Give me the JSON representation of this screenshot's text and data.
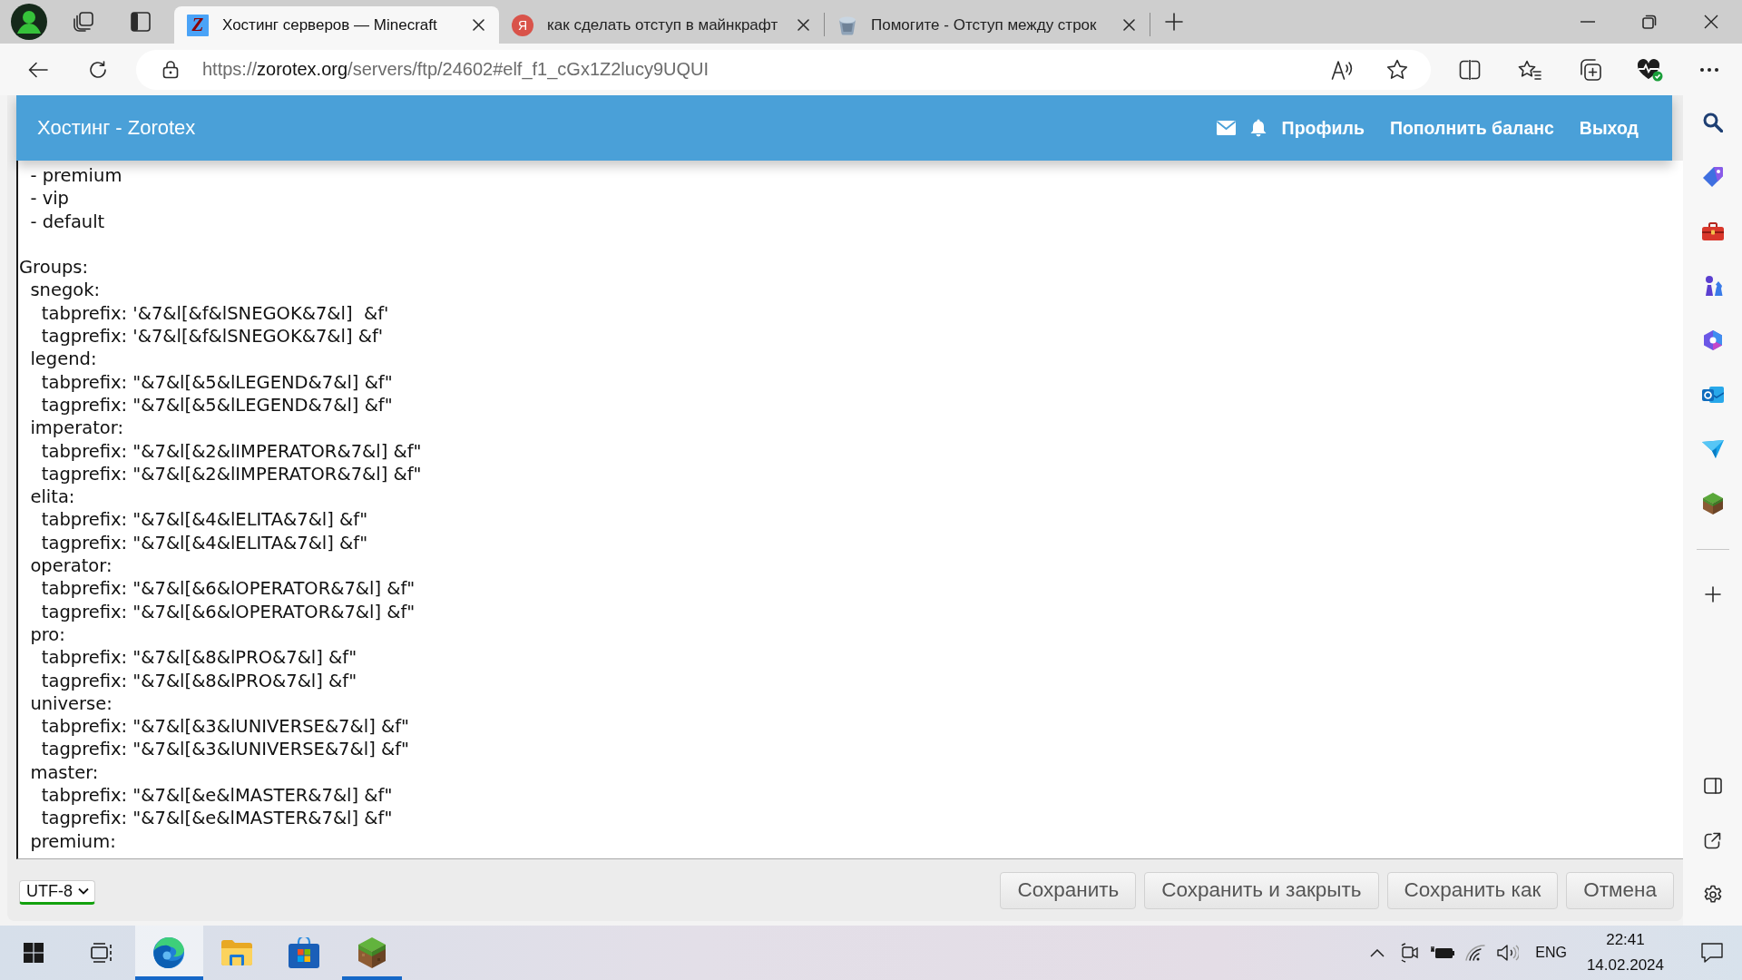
{
  "browser": {
    "tabs": [
      {
        "favicon": {
          "kind": "square",
          "letter": "Z"
        },
        "title": "Хостинг серверов — Minecraft",
        "selected": true
      },
      {
        "favicon": {
          "kind": "circle",
          "letter": "Я"
        },
        "title": "как сделать отступ в майнкрафт",
        "selected": false
      },
      {
        "favicon": {
          "kind": "picture"
        },
        "title": "Помогите - Отступ между строк",
        "selected": false
      }
    ],
    "address": {
      "scheme": "https://",
      "host": "zorotex.org",
      "path": "/servers/ftp/24602#elf_f1_cGx1Z2lucy9UQUI"
    }
  },
  "site": {
    "title": "Хостинг - Zorotex",
    "links": [
      "Профиль",
      "Пополнить баланс",
      "Выход"
    ]
  },
  "editor": {
    "blocks": [
      {
        "lines": [
          "  - premium",
          "  - vip",
          "  - default"
        ]
      },
      {
        "lines": [
          "Groups:",
          "  snegok:",
          "    tabprefix: '&7&l[&f&lSNEGOK&7&l]  &f'",
          "    tagprefix: '&7&l[&f&lSNEGOK&7&l] &f'",
          "  legend:",
          "    tabprefix: \"&7&l[&5&lLEGEND&7&l] &f\"",
          "    tagprefix: \"&7&l[&5&lLEGEND&7&l] &f\"",
          "  imperator:",
          "    tabprefix: \"&7&l[&2&lIMPERATOR&7&l] &f\"",
          "    tagprefix: \"&7&l[&2&lIMPERATOR&7&l] &f\"",
          "  elita:",
          "    tabprefix: \"&7&l[&4&lELITA&7&l] &f\"",
          "    tagprefix: \"&7&l[&4&lELITA&7&l] &f\"",
          "  operator:",
          "    tabprefix: \"&7&l[&6&lOPERATOR&7&l] &f\"",
          "    tagprefix: \"&7&l[&6&lOPERATOR&7&l] &f\"",
          "  pro:",
          "    tabprefix: \"&7&l[&8&lPRO&7&l] &f\"",
          "    tagprefix: \"&7&l[&8&lPRO&7&l] &f\"",
          "  universe:",
          "    tabprefix: \"&7&l[&3&lUNIVERSE&7&l] &f\"",
          "    tagprefix: \"&7&l[&3&lUNIVERSE&7&l] &f\"",
          "  master:",
          "    tabprefix: \"&7&l[&e&lMASTER&7&l] &f\"",
          "    tagprefix: \"&7&l[&e&lMASTER&7&l] &f\"",
          "  premium:"
        ]
      }
    ]
  },
  "footer": {
    "encoding": "UTF-8",
    "buttons": [
      "Сохранить",
      "Сохранить и закрыть",
      "Сохранить как",
      "Отмена"
    ]
  },
  "taskbar": {
    "apps": [
      {
        "kind": "browser",
        "selected": true,
        "running": true
      },
      {
        "kind": "folder",
        "selected": false,
        "running": false
      },
      {
        "kind": "store",
        "selected": false,
        "running": false
      },
      {
        "kind": "game",
        "selected": false,
        "running": true
      }
    ],
    "language": "ENG",
    "time": "22:41",
    "date": "14.02.2024"
  }
}
